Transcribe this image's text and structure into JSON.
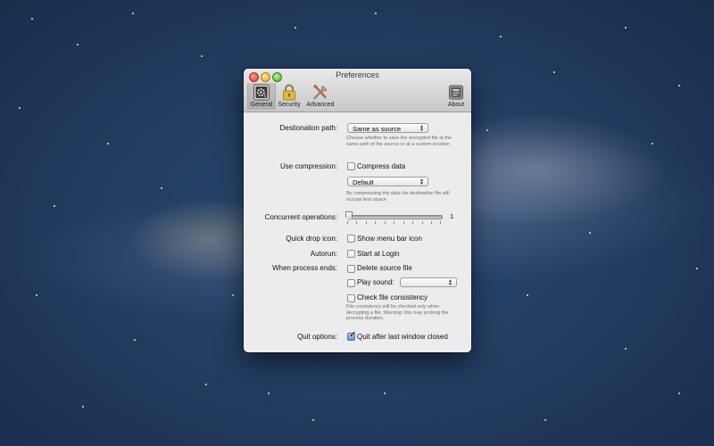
{
  "window": {
    "title": "Preferences"
  },
  "toolbar": {
    "items": [
      {
        "label": "General",
        "icon": "general-icon",
        "selected": true
      },
      {
        "label": "Security",
        "icon": "lock-icon",
        "selected": false
      },
      {
        "label": "Advanced",
        "icon": "tools-icon",
        "selected": false
      },
      {
        "label": "About",
        "icon": "about-icon",
        "selected": false
      }
    ]
  },
  "form": {
    "destination": {
      "label": "Destionation path:",
      "value": "Same as source",
      "note": "Choose whether to save the encrypted file at the same path of the source or at a custom location"
    },
    "compression": {
      "label": "Use compression:",
      "checkbox_label": "Compress data",
      "checked": false,
      "level_value": "Default",
      "note": "By compressing the data the destination file will occupy less space"
    },
    "concurrent": {
      "label": "Concurrent operations:",
      "value": "1"
    },
    "quick_drop": {
      "label": "Quick drop icon:",
      "checkbox_label": "Show menu bar icon",
      "checked": false
    },
    "autorun": {
      "label": "Autorun:",
      "checkbox_label": "Start at Login",
      "checked": false
    },
    "process_end": {
      "label": "When process ends:",
      "delete_label": "Delete source file",
      "delete_checked": false,
      "sound_label": "Play sound:",
      "sound_checked": false,
      "sound_value": "",
      "consistency_label": "Check file consistency",
      "consistency_checked": false,
      "consistency_note": "File consistency will be checked only when decrypting a file. Warning: this may prolong the process duration."
    },
    "quit": {
      "label": "Quit options:",
      "checkbox_label": "Quit after last window closed",
      "checked": true
    }
  }
}
